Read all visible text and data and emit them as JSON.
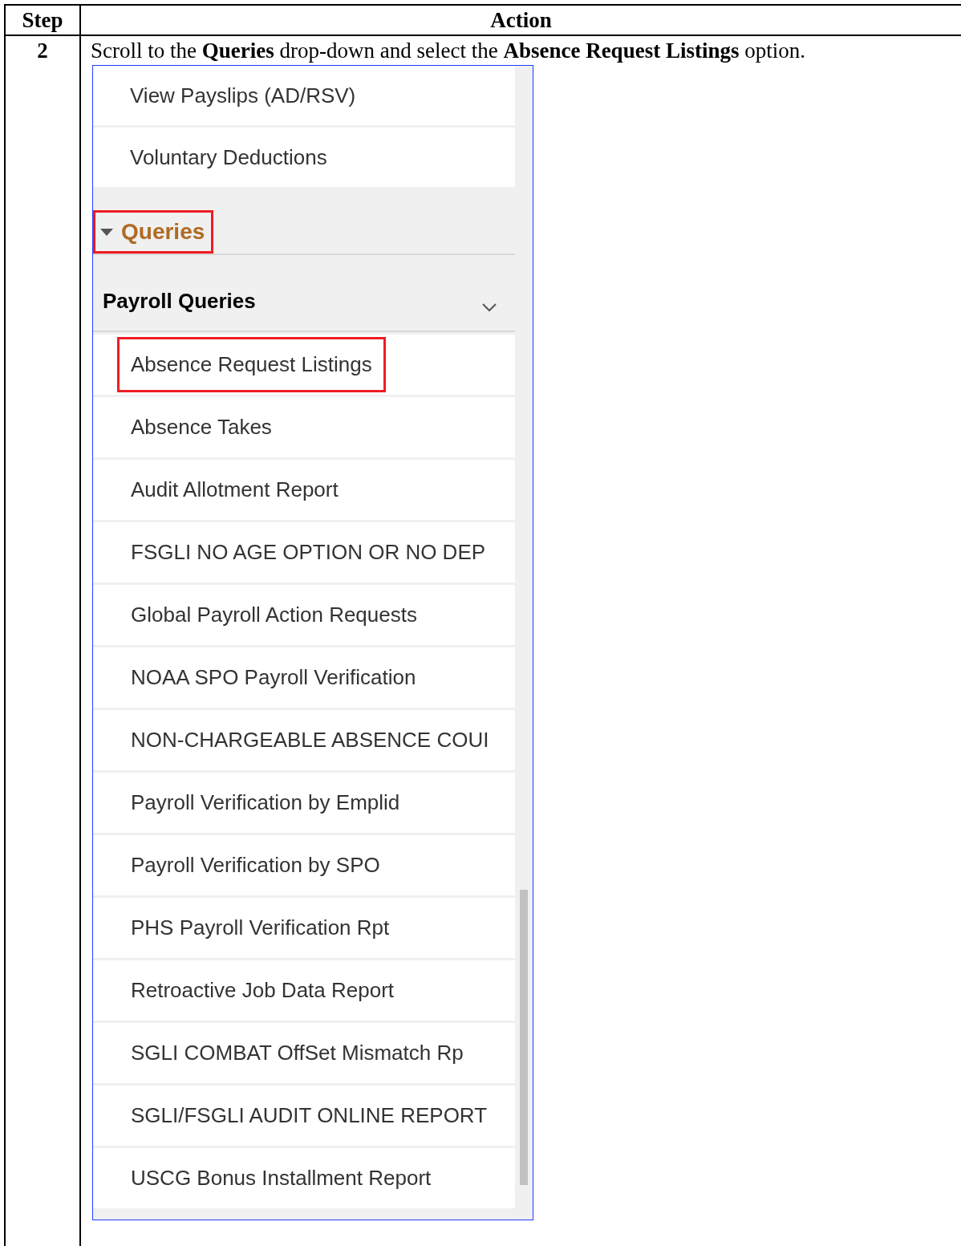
{
  "table": {
    "columns": [
      "Step",
      "Action"
    ],
    "rows": [
      {
        "step": "2",
        "instruction": "Scroll to the **Queries** drop-down and select the **Absence Request Listings** option.",
        "screenshot": {
          "top_items": [
            {
              "label": "View Payslips (AD/RSV)"
            },
            {
              "label": "Voluntary Deductions"
            }
          ],
          "section": {
            "label": "Queries",
            "expanded": true,
            "highlighted": true,
            "group": {
              "label": "Payroll Queries",
              "expanded": true,
              "items": [
                {
                  "label": "Absence Request Listings",
                  "highlighted": true
                },
                {
                  "label": "Absence Takes",
                  "highlighted": false
                },
                {
                  "label": "Audit Allotment Report",
                  "highlighted": false
                },
                {
                  "label": "FSGLI NO AGE OPTION OR NO DEP",
                  "highlighted": false
                },
                {
                  "label": "Global Payroll Action Requests",
                  "highlighted": false
                },
                {
                  "label": "NOAA SPO Payroll Verification",
                  "highlighted": false
                },
                {
                  "label": "NON-CHARGEABLE ABSENCE COUI",
                  "highlighted": false
                },
                {
                  "label": "Payroll Verification by Emplid",
                  "highlighted": false
                },
                {
                  "label": "Payroll Verification by SPO",
                  "highlighted": false
                },
                {
                  "label": "PHS Payroll Verification Rpt",
                  "highlighted": false
                },
                {
                  "label": "Retroactive Job Data Report",
                  "highlighted": false
                },
                {
                  "label": "SGLI COMBAT OffSet Mismatch Rp",
                  "highlighted": false
                },
                {
                  "label": "SGLI/FSGLI AUDIT ONLINE REPORT",
                  "highlighted": false
                },
                {
                  "label": "USCG Bonus Installment Report",
                  "highlighted": false
                }
              ]
            }
          }
        }
      }
    ]
  }
}
